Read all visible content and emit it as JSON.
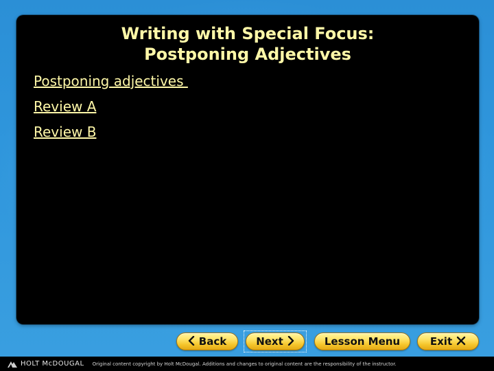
{
  "slide": {
    "title_line1": "Writing with Special Focus:",
    "title_line2": "Postponing Adjectives",
    "links": [
      {
        "label": "Postponing adjectives "
      },
      {
        "label": "Review A"
      },
      {
        "label": "Review B"
      }
    ]
  },
  "nav": {
    "back_label": "Back",
    "next_label": "Next",
    "lesson_menu_label": "Lesson Menu",
    "exit_label": "Exit"
  },
  "footer": {
    "logo_text": "HOLT McDOUGAL",
    "copyright": "Original content copyright by Holt McDougal. Additions and changes to original content are the responsibility of the instructor."
  },
  "colors": {
    "background": "#2f96dc",
    "panel": "#000000",
    "text_yellow": "#fff8a8",
    "button": "#f5c52a"
  },
  "icons": {
    "back": "chevron-left-icon",
    "next": "chevron-right-icon",
    "exit": "close-icon",
    "logo": "holt-mcdougal-logo-icon"
  }
}
